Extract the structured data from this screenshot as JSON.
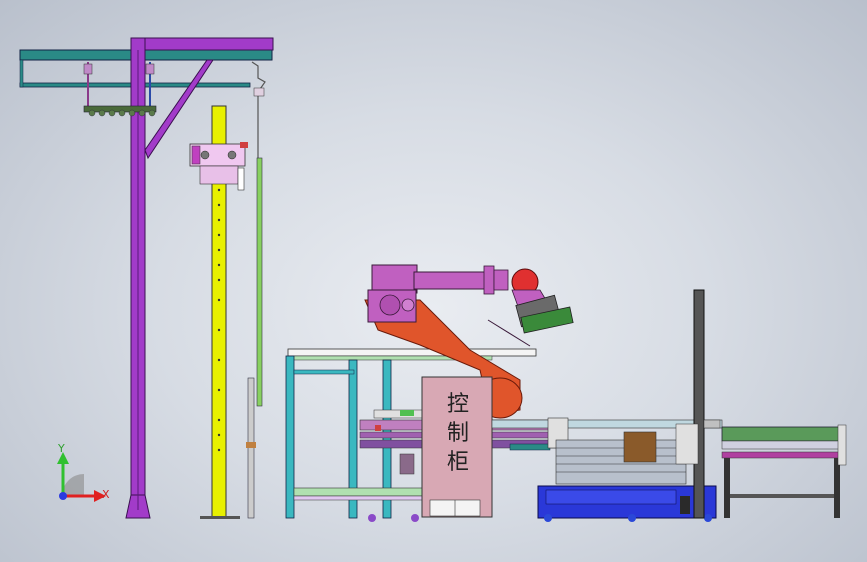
{
  "cabinet": {
    "chars": [
      "控",
      "制",
      "柜"
    ]
  },
  "axis_triad": {
    "y_label": "Y",
    "x_label": "X"
  },
  "colors": {
    "gantry_purple": "#a23bc9",
    "column_yellow": "#e8f000",
    "robot_orange": "#e0552b",
    "robot_magenta": "#c060c0",
    "cabinet_pink": "#d8a8b4",
    "conveyor_blue": "#2a38d8",
    "beam_teal": "#2a8a86",
    "frame_cyan": "#2ab3b8"
  }
}
